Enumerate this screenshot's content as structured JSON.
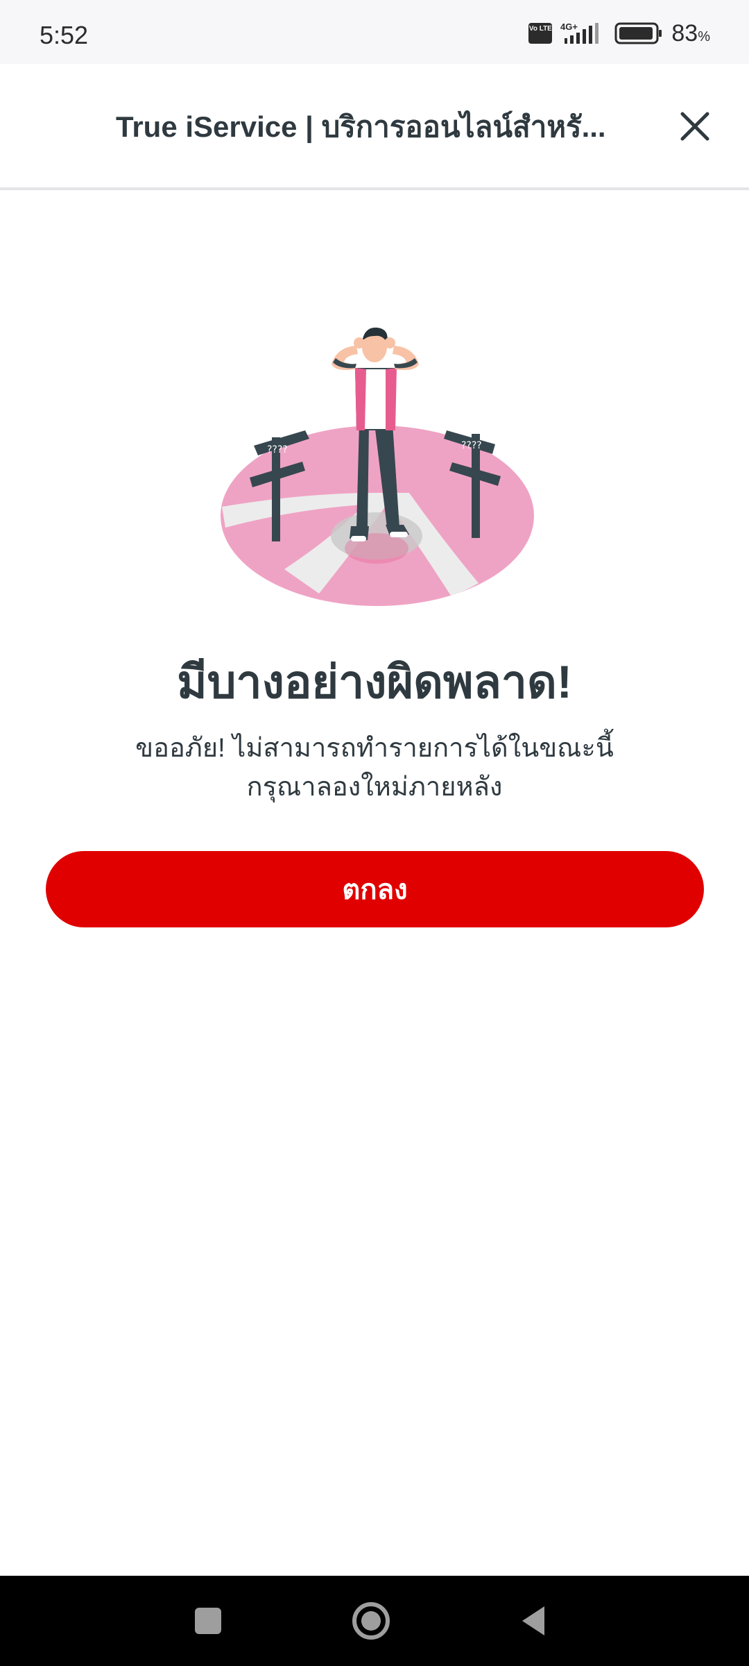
{
  "status_bar": {
    "time": "5:52",
    "network": "4G+",
    "volte": "Vo LTE",
    "battery_percent": "83",
    "percent_sign": "%",
    "icons": [
      "volte-icon",
      "signal-icon",
      "battery-icon"
    ]
  },
  "header": {
    "title": "True iService | บริการออนไลน์สำหรั...",
    "close_icon": "close-icon"
  },
  "illustration": {
    "name": "confused-person-crossroads-illustration",
    "sign_text": "????",
    "colors": {
      "pink": "#efa3c4",
      "accent_pink": "#e75c8e",
      "dark": "#37474f"
    }
  },
  "error": {
    "title": "มีบางอย่างผิดพลาด!",
    "message_line1": "ขออภัย! ไม่สามารถทำรายการได้ในขณะนี้",
    "message_line2": "กรุณาลองใหม่ภายหลัง"
  },
  "actions": {
    "ok_label": "ตกลง"
  },
  "theme": {
    "primary": "#e00000",
    "text": "#2f3a40"
  },
  "nav_bar": {
    "icons": [
      "recents-icon",
      "home-icon",
      "back-icon"
    ]
  }
}
